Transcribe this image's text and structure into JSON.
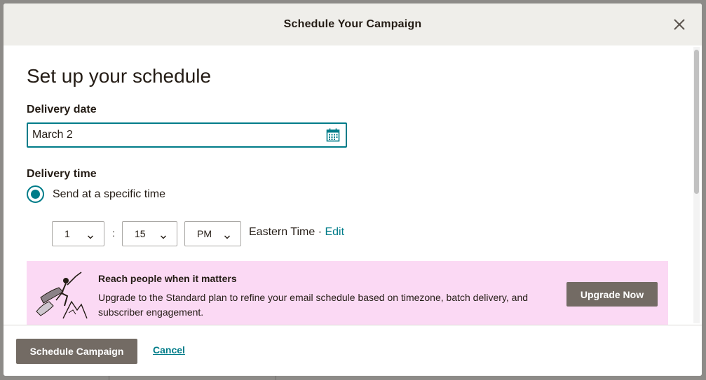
{
  "modal": {
    "title": "Schedule Your Campaign"
  },
  "body": {
    "heading": "Set up your schedule",
    "delivery_date": {
      "label": "Delivery date",
      "value": "March 2"
    },
    "delivery_time": {
      "label": "Delivery time",
      "option_label": "Send at a specific time",
      "option_selected": true,
      "hour": "1",
      "minute": "15",
      "meridiem": "PM",
      "separator": ":",
      "timezone": "Eastern Time",
      "timezone_sep": " · ",
      "edit_label": "Edit"
    },
    "promo": {
      "title": "Reach people when it matters",
      "text": "Upgrade to the Standard plan to refine your email schedule based on timezone, batch delivery, and subscriber engagement.",
      "button_label": "Upgrade Now"
    }
  },
  "footer": {
    "schedule_label": "Schedule Campaign",
    "cancel_label": "Cancel"
  },
  "colors": {
    "accent": "#007c89",
    "button": "#736b64",
    "promo_bg": "#fbd9f4",
    "header_bg": "#efeeea"
  },
  "icons": {
    "close": "close-icon",
    "calendar": "calendar-icon",
    "chevron": "chevron-down-icon"
  }
}
